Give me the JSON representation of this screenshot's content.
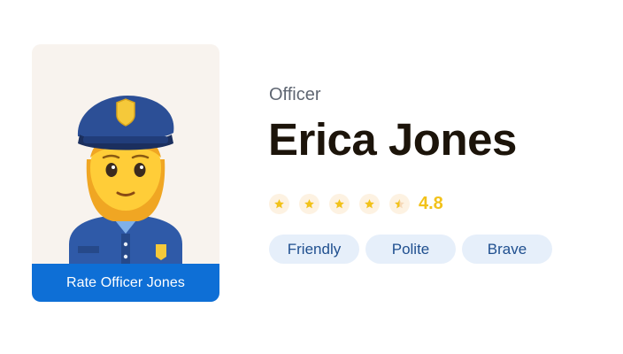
{
  "profile": {
    "role": "Officer",
    "name": "Erica Jones",
    "rate_button_label": "Rate Officer Jones",
    "avatar_icon": "police-officer-emoji"
  },
  "rating": {
    "value": "4.8",
    "stars_filled": 4.5,
    "stars_total": 5,
    "star_color": "#f2c21b"
  },
  "tags": [
    "Friendly",
    "Polite",
    "Brave"
  ],
  "colors": {
    "accent": "#0e6fd6",
    "tag_bg": "#e6effa",
    "tag_text": "#1f4f8f"
  }
}
